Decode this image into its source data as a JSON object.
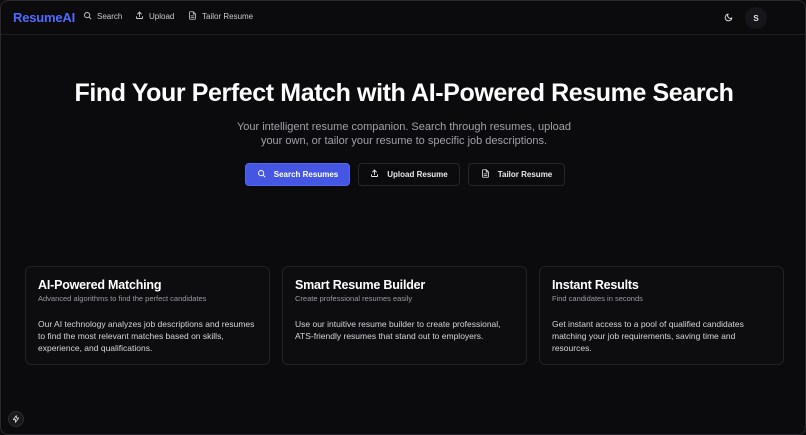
{
  "navbar": {
    "brand": "ResumeAI",
    "links": [
      {
        "label": "Search",
        "icon": "search-icon"
      },
      {
        "label": "Upload",
        "icon": "upload-icon"
      },
      {
        "label": "Tailor Resume",
        "icon": "document-icon"
      }
    ],
    "theme_icon": "moon-icon",
    "avatar_initial": "S"
  },
  "hero": {
    "title": "Find Your Perfect Match with AI-Powered Resume Search",
    "subtitle": "Your intelligent resume companion. Search through resumes, upload your own, or tailor your resume to specific job descriptions.",
    "buttons": [
      {
        "label": "Search Resumes",
        "icon": "search-icon",
        "style": "primary"
      },
      {
        "label": "Upload Resume",
        "icon": "upload-icon",
        "style": "outline"
      },
      {
        "label": "Tailor Resume",
        "icon": "document-icon",
        "style": "outline"
      }
    ]
  },
  "features": [
    {
      "title": "AI-Powered Matching",
      "subtitle": "Advanced algorithms to find the perfect candidates",
      "body": "Our AI technology analyzes job descriptions and resumes to find the most relevant matches based on skills, experience, and qualifications."
    },
    {
      "title": "Smart Resume Builder",
      "subtitle": "Create professional resumes easily",
      "body": "Use our intuitive resume builder to create professional, ATS-friendly resumes that stand out to employers."
    },
    {
      "title": "Instant Results",
      "subtitle": "Find candidates in seconds",
      "body": "Get instant access to a pool of qualified candidates matching your job requirements, saving time and resources."
    }
  ],
  "fab_icon": "lightning-icon",
  "colors": {
    "background": "#0b0b0d",
    "brand": "#4f6bff",
    "primary_button": "#4556e3",
    "card_border": "#222226"
  }
}
